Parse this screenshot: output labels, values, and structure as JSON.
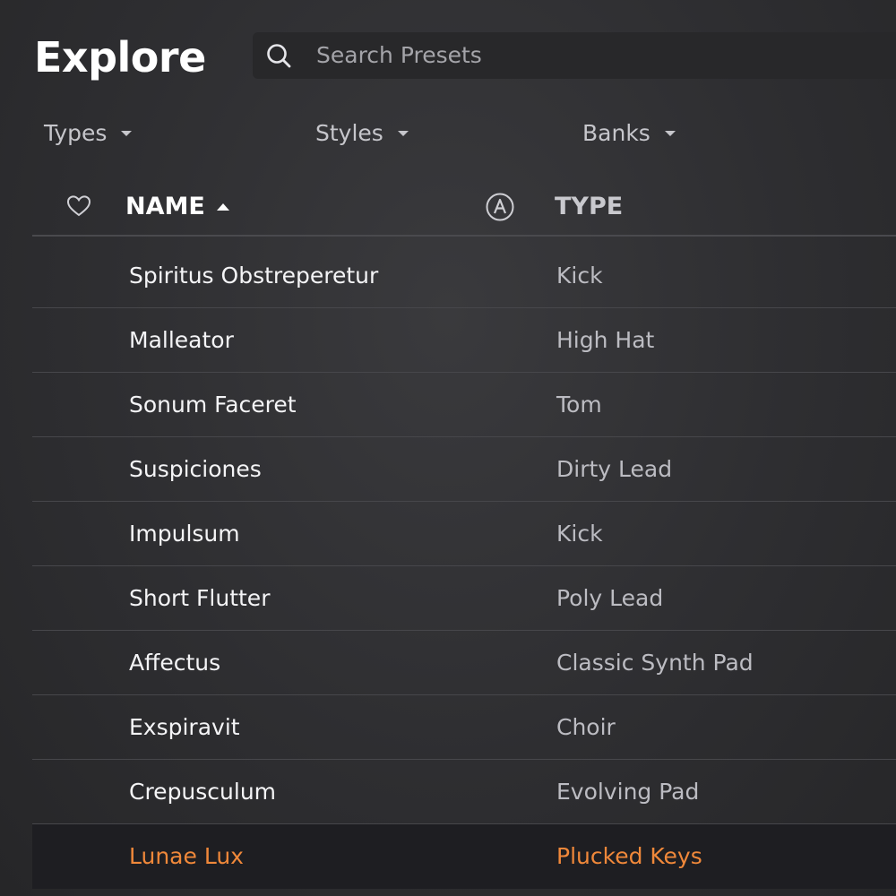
{
  "page": {
    "title": "Explore"
  },
  "search": {
    "placeholder": "Search Presets",
    "icon": "search-icon"
  },
  "filters": [
    {
      "label": "Types"
    },
    {
      "label": "Styles"
    },
    {
      "label": "Banks"
    }
  ],
  "table_header": {
    "favorite_icon": "heart-outline-icon",
    "name_label": "NAME",
    "name_sort": "ascending",
    "arturia_icon": "arturia-logo-icon",
    "type_label": "TYPE"
  },
  "presets": [
    {
      "name": "Spiritus Obstreperetur",
      "type": "Kick"
    },
    {
      "name": "Malleator",
      "type": "High Hat"
    },
    {
      "name": "Sonum Faceret",
      "type": "Tom"
    },
    {
      "name": "Suspiciones",
      "type": "Dirty Lead"
    },
    {
      "name": "Impulsum",
      "type": "Kick"
    },
    {
      "name": "Short Flutter",
      "type": "Poly Lead"
    },
    {
      "name": "Affectus",
      "type": "Classic Synth Pad"
    },
    {
      "name": "Exspiravit",
      "type": "Choir"
    },
    {
      "name": "Crepusculum",
      "type": "Evolving Pad"
    },
    {
      "name": "Lunae Lux",
      "type": "Plucked Keys",
      "selected": true
    }
  ],
  "colors": {
    "selected_accent": "#f0883a",
    "background": "#2e2e31",
    "selected_row_bg": "#1e1e22"
  }
}
